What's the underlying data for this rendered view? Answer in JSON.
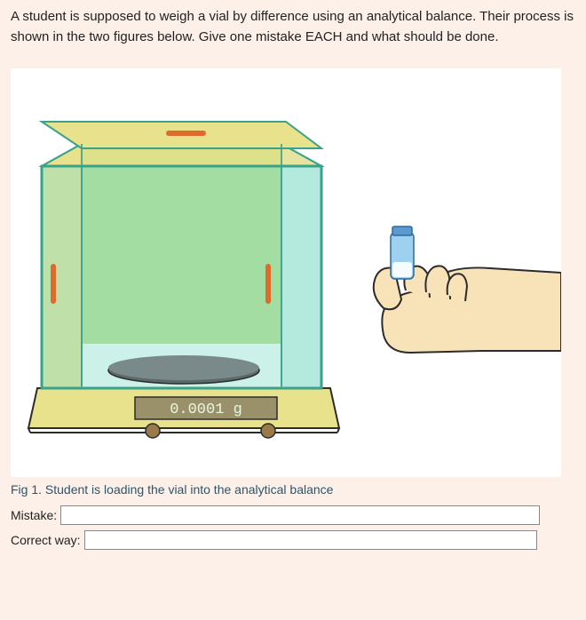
{
  "prompt": "A student is supposed to weigh a vial by difference using an analytical balance. Their process is shown in the two figures below. Give one mistake EACH and what should be done.",
  "figure1": {
    "balance_readout": "0.0001 g",
    "caption": "Fig 1. Student is loading the vial into the analytical balance"
  },
  "fields": {
    "mistake_label": "Mistake:",
    "mistake_value": "",
    "correct_label": "Correct way:",
    "correct_value": ""
  }
}
